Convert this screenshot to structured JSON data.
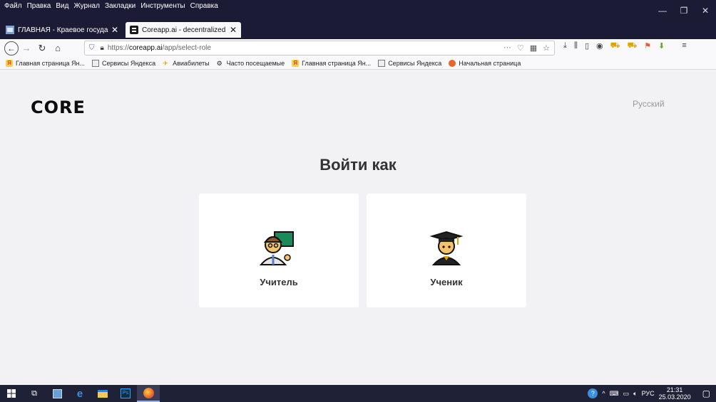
{
  "menu": [
    "Файл",
    "Правка",
    "Вид",
    "Журнал",
    "Закладки",
    "Инструменты",
    "Справка"
  ],
  "tabs": [
    {
      "title": "ГЛАВНАЯ - Краевое государс",
      "close": "✕"
    },
    {
      "title": "Coreapp.ai - decentralized onli",
      "close": "✕"
    }
  ],
  "new_tab": "+",
  "url": {
    "prefix": "https://",
    "host": "coreapp.ai",
    "path": "/app/select-role"
  },
  "bookmarks": [
    "Главная страница Ян...",
    "Сервисы Яндекса",
    "Авиабилеты",
    "Часто посещаемые",
    "Главная страница Ян...",
    "Сервисы Яндекса",
    "Начальная страница"
  ],
  "page": {
    "logo": "CORE",
    "language": "Русский",
    "heading": "Войти как",
    "roles": [
      {
        "label": "Учитель"
      },
      {
        "label": "Ученик"
      }
    ]
  },
  "taskbar": {
    "lang": "РУС",
    "time": "21:31",
    "date": "25.03.2020"
  },
  "colors": {
    "chrome_dark": "#1c1b36",
    "page_bg": "#f2f2f5",
    "card_bg": "#ffffff",
    "heading": "#333333"
  }
}
